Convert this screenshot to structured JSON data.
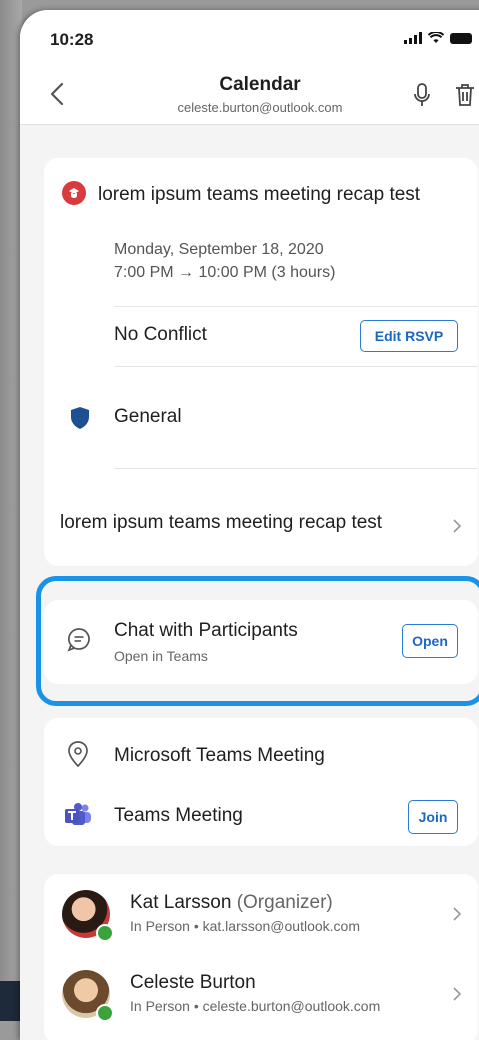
{
  "status": {
    "time": "10:28"
  },
  "header": {
    "title": "Calendar",
    "account": "celeste.burton@outlook.com"
  },
  "event": {
    "title": "lorem ipsum teams meeting recap test",
    "date": "Monday, September 18, 2020",
    "time_range": "7:00 PM → 10:00 PM (3 hours)",
    "conflict_status": "No Conflict",
    "edit_rsvp_label": "Edit RSVP",
    "channel": "General",
    "recap_link": "lorem ipsum teams meeting recap test"
  },
  "chat": {
    "title": "Chat with Participants",
    "subtitle": "Open in Teams",
    "open_label": "Open"
  },
  "meeting": {
    "location": "Microsoft Teams Meeting",
    "teams_label": "Teams Meeting",
    "join_label": "Join"
  },
  "attendees": [
    {
      "name": "Kat Larsson",
      "role": "(Organizer)",
      "detail": "In Person • kat.larsson@outlook.com"
    },
    {
      "name": "Celeste Burton",
      "role": "",
      "detail": "In Person • celeste.burton@outlook.com"
    }
  ],
  "colors": {
    "accent": "#1a68c0",
    "highlight": "#1893e8",
    "event_icon": "#d83b3b",
    "presence": "#3aa33a"
  }
}
